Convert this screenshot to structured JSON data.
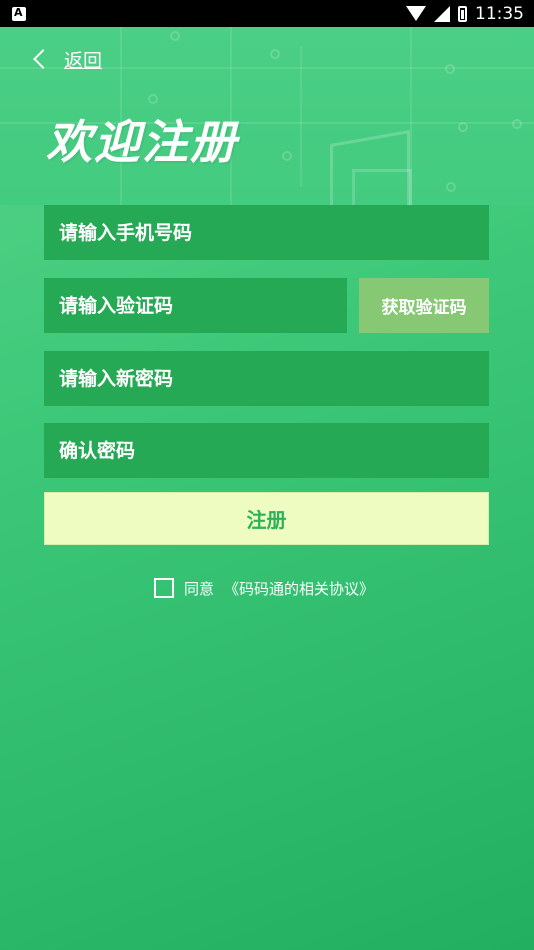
{
  "status_bar": {
    "time": "11:35"
  },
  "header": {
    "back_label": "返回",
    "title": "欢迎注册"
  },
  "form": {
    "phone_placeholder": "请输入手机号码",
    "code_placeholder": "请输入验证码",
    "get_code_label": "获取验证码",
    "new_password_placeholder": "请输入新密码",
    "confirm_password_placeholder": "确认密码",
    "register_label": "注册"
  },
  "agreement": {
    "agree_label": "同意",
    "agreement_link": "《码码通的相关协议》"
  },
  "colors": {
    "accent_green": "#2bb25a",
    "field_bg": "#26a955",
    "code_button_bg": "#86c873",
    "register_button_bg": "#eefcc2"
  }
}
